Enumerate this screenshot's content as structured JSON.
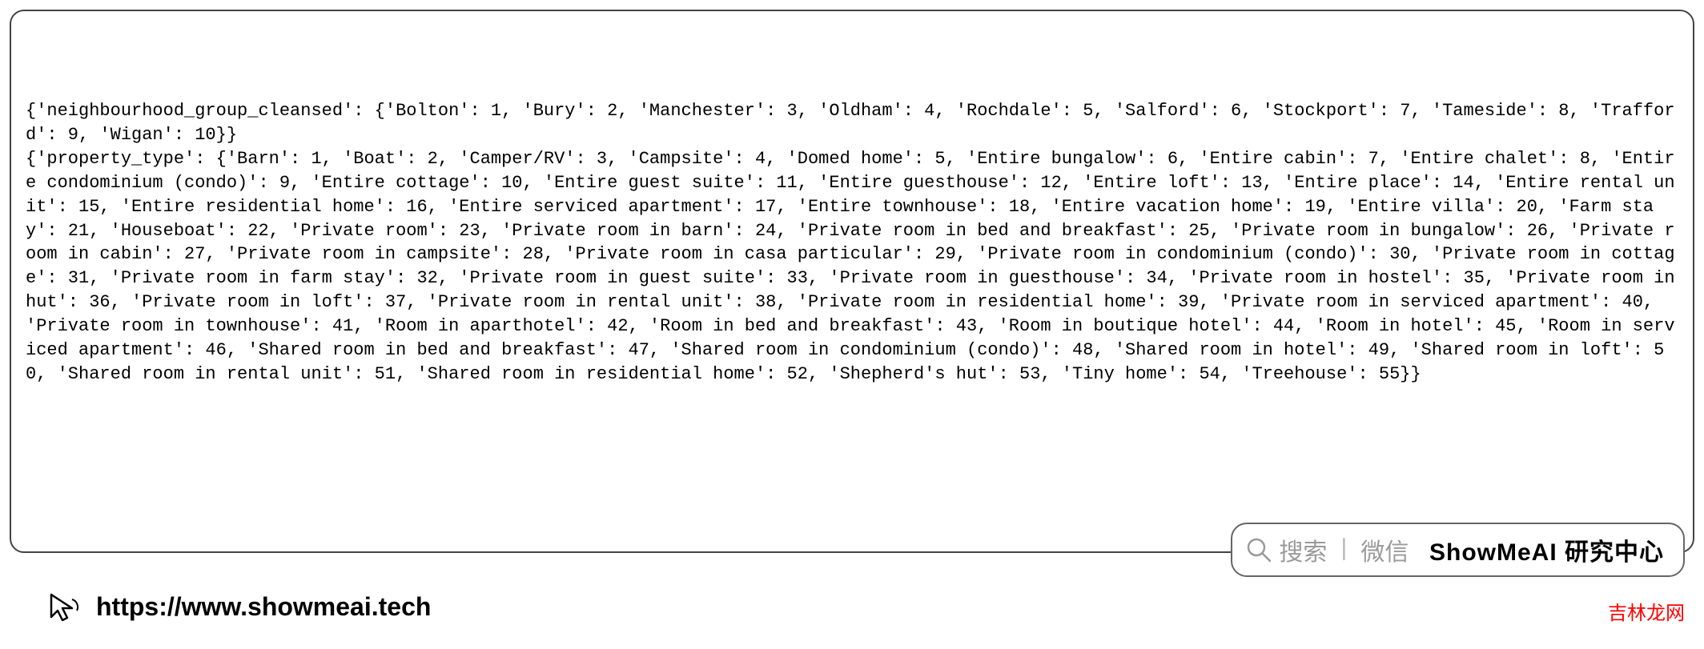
{
  "code_text": "{'neighbourhood_group_cleansed': {'Bolton': 1, 'Bury': 2, 'Manchester': 3, 'Oldham': 4, 'Rochdale': 5, 'Salford': 6, 'Stockport': 7, 'Tameside': 8, 'Trafford': 9, 'Wigan': 10}}\n{'property_type': {'Barn': 1, 'Boat': 2, 'Camper/RV': 3, 'Campsite': 4, 'Domed home': 5, 'Entire bungalow': 6, 'Entire cabin': 7, 'Entire chalet': 8, 'Entire condominium (condo)': 9, 'Entire cottage': 10, 'Entire guest suite': 11, 'Entire guesthouse': 12, 'Entire loft': 13, 'Entire place': 14, 'Entire rental unit': 15, 'Entire residential home': 16, 'Entire serviced apartment': 17, 'Entire townhouse': 18, 'Entire vacation home': 19, 'Entire villa': 20, 'Farm stay': 21, 'Houseboat': 22, 'Private room': 23, 'Private room in barn': 24, 'Private room in bed and breakfast': 25, 'Private room in bungalow': 26, 'Private room in cabin': 27, 'Private room in campsite': 28, 'Private room in casa particular': 29, 'Private room in condominium (condo)': 30, 'Private room in cottage': 31, 'Private room in farm stay': 32, 'Private room in guest suite': 33, 'Private room in guesthouse': 34, 'Private room in hostel': 35, 'Private room in hut': 36, 'Private room in loft': 37, 'Private room in rental unit': 38, 'Private room in residential home': 39, 'Private room in serviced apartment': 40, 'Private room in townhouse': 41, 'Room in aparthotel': 42, 'Room in bed and breakfast': 43, 'Room in boutique hotel': 44, 'Room in hotel': 45, 'Room in serviced apartment': 46, 'Shared room in bed and breakfast': 47, 'Shared room in condominium (condo)': 48, 'Shared room in hotel': 49, 'Shared room in loft': 50, 'Shared room in rental unit': 51, 'Shared room in residential home': 52, 'Shepherd's hut': 53, 'Tiny home': 54, 'Treehouse': 55}}",
  "search_pill": {
    "search_label": "搜索",
    "wechat_label": "微信",
    "brand": "ShowMeAI 研究中心"
  },
  "footer": {
    "url": "https://www.showmeai.tech"
  },
  "brand_mark": "吉林龙网"
}
